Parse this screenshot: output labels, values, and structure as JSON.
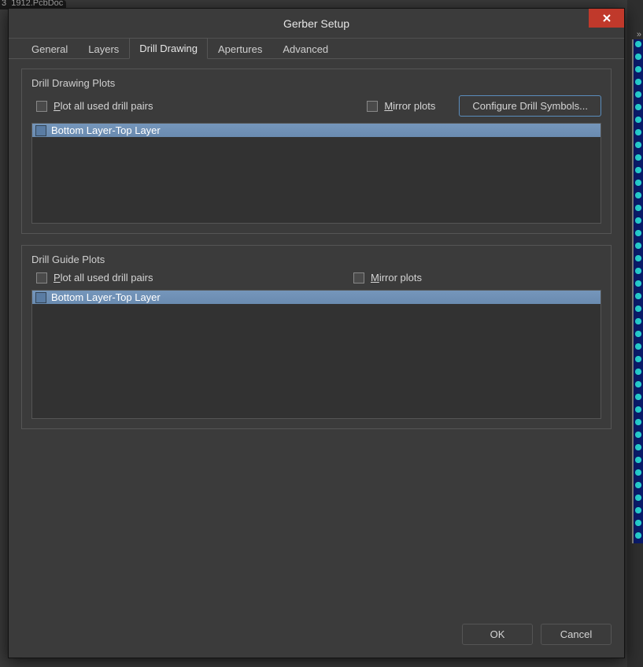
{
  "bg": {
    "filename": "3_1912.PcbDoc"
  },
  "dialog": {
    "title": "Gerber Setup",
    "tabs": {
      "general": "General",
      "layers": "Layers",
      "drilldrawing": "Drill Drawing",
      "apertures": "Apertures",
      "advanced": "Advanced"
    },
    "group1": {
      "label": "Drill Drawing Plots",
      "plot_all": "lot all used drill pairs",
      "plot_all_prefix": "P",
      "mirror": "irror plots",
      "mirror_prefix": "M",
      "configure": "Configure Drill Symbols...",
      "item": "Bottom Layer-Top Layer"
    },
    "group2": {
      "label": "Drill Guide Plots",
      "plot_all": "lot all used drill pairs",
      "plot_all_prefix": "P",
      "mirror": "irror plots",
      "mirror_prefix": "M",
      "item": "Bottom Layer-Top Layer"
    },
    "buttons": {
      "ok": "OK",
      "cancel": "Cancel"
    }
  }
}
